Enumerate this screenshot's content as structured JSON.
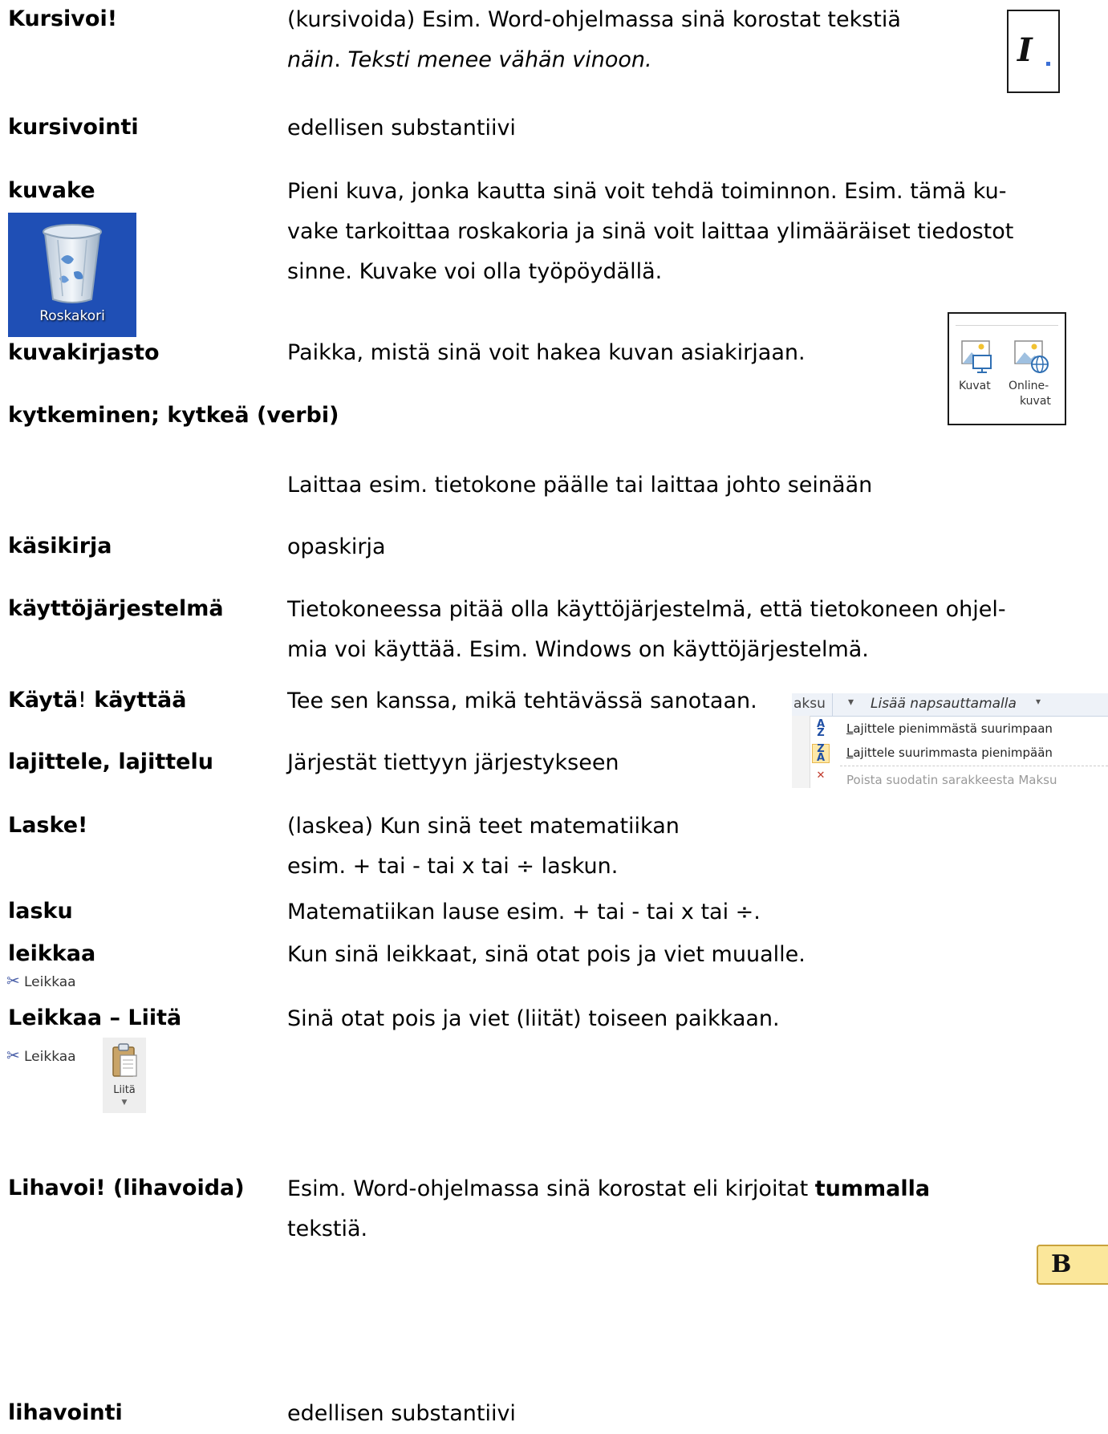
{
  "entries": {
    "kursivoi": {
      "term": "Kursivoi!",
      "line1": "(kursivoida) Esim. Word-ohjelmassa sinä korostat tekstiä",
      "line2_italic": "näin",
      "line2_sep": ". ",
      "line2_rest": "Teksti menee vähän vinoon."
    },
    "kursivointi": {
      "term": "kursivointi",
      "def": "edellisen substantiivi"
    },
    "kuvake": {
      "term": "kuvake",
      "line1": "Pieni kuva, jonka kautta sinä voit tehdä toiminnon. Esim. tämä ku-",
      "line2": "vake tarkoittaa roskakoria ja sinä voit laittaa ylimääräiset tiedostot",
      "line3": "sinne. Kuvake voi olla työpöydällä."
    },
    "kuvakirjasto": {
      "term": "kuvakirjasto",
      "def": "Paikka, mistä sinä voit hakea kuvan asiakirjaan."
    },
    "kytkeminen": {
      "term": "kytkeminen; kytkeä (verbi)",
      "def": "Laittaa esim. tietokone päälle tai laittaa johto seinään"
    },
    "kasikirja": {
      "term": "käsikirja",
      "def": "opaskirja"
    },
    "kayttojarjestelma": {
      "term": "käyttöjärjestelmä",
      "line1": "Tietokoneessa pitää olla käyttöjärjestelmä, että tietokoneen ohjel-",
      "line2": "mia voi käyttää. Esim. Windows on käyttöjärjestelmä."
    },
    "kayta": {
      "term_a": "Käytä",
      "term_b": "!",
      "term_c": " käyttää",
      "def": "Tee sen kanssa, mikä tehtävässä sanotaan."
    },
    "lajittele": {
      "term": "lajittele, lajittelu",
      "def": "Järjestät tiettyyn järjestykseen"
    },
    "laske": {
      "term": "Laske!",
      "line1": "(laskea) Kun sinä teet matematiikan",
      "line2": "esim. + tai - tai x tai ÷ laskun."
    },
    "lasku": {
      "term": "lasku",
      "def": "Matematiikan lause esim. + tai - tai x tai ÷."
    },
    "leikkaa": {
      "term": "leikkaa",
      "def": "Kun sinä leikkaat, sinä otat pois ja viet muualle."
    },
    "leikkaa_liita": {
      "term": "Leikkaa – Liitä",
      "def": "Sinä otat pois ja viet (liität) toiseen paikkaan."
    },
    "lihavoi": {
      "term": "Lihavoi! (lihavoida)",
      "line1_a": "Esim. Word-ohjelmassa sinä korostat eli kirjoitat ",
      "line1_bold": "tummalla",
      "line2": "tekstiä."
    },
    "lihavointi": {
      "term": "lihavointi",
      "def": "edellisen substantiivi"
    }
  },
  "icons": {
    "italic_glyph": "I",
    "recycle_caption": "Roskakori",
    "kuvat_label": "Kuvat",
    "online_label_1": "Online-",
    "online_label_2": "kuvat",
    "cut_label": "Leikkaa",
    "paste_label": "Liitä",
    "bold_glyph": "B"
  },
  "sort_panel": {
    "col_header": "aksu",
    "add_header": "Lisää napsauttamalla",
    "items": [
      {
        "icon": "sort-ascending-icon",
        "u": "L",
        "text": "ajittele pienimmästä suurimpaan"
      },
      {
        "icon": "sort-descending-icon",
        "u": "L",
        "text": "ajittele suurimmasta pienimpään"
      },
      {
        "icon": "clear-filter-icon",
        "u": "",
        "text": "Poista suodatin sarakkeesta Maksu"
      }
    ]
  },
  "colors": {
    "desktop_blue": "#1f4fb5",
    "highlight_yellow": "#fbe79b"
  }
}
